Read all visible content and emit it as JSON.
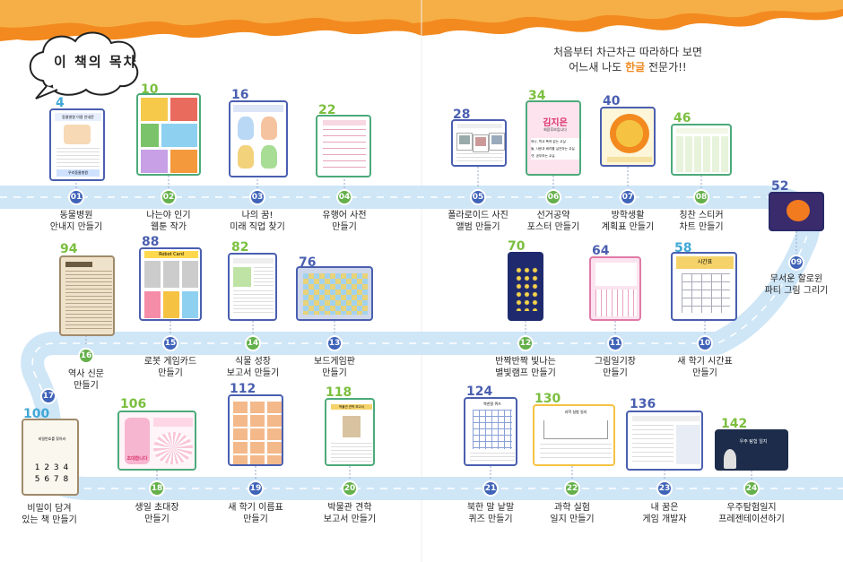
{
  "header": {
    "title": "이 책의 목차",
    "tagline_line1": "처음부터 차근차근 따라하다 보면",
    "tagline_line2_pre": "어느새 나도 ",
    "tagline_highlight": "한글",
    "tagline_line2_post": " 전문가!!"
  },
  "colors": {
    "wave": "#f39a2b",
    "road": "#cfe6f7",
    "badge_blue": "#3f63b8",
    "badge_green": "#64b04a",
    "page_blue": "#3fa7d6",
    "page_green": "#7bbf3f"
  },
  "items": [
    {
      "num": "01",
      "page": "4",
      "label": [
        "동물병원",
        "안내지 만들기"
      ]
    },
    {
      "num": "02",
      "page": "10",
      "label": [
        "나는야 인기",
        "웹툰 작가"
      ]
    },
    {
      "num": "03",
      "page": "16",
      "label": [
        "나의 꿈!",
        "미래 직업 찾기"
      ]
    },
    {
      "num": "04",
      "page": "22",
      "label": [
        "유행어 사전",
        "만들기"
      ]
    },
    {
      "num": "05",
      "page": "28",
      "label": [
        "폴라로이드 사진",
        "앨범 만들기"
      ]
    },
    {
      "num": "06",
      "page": "34",
      "label": [
        "선거공약",
        "포스터 만들기"
      ]
    },
    {
      "num": "07",
      "page": "40",
      "label": [
        "방학생활",
        "계획표 만들기"
      ]
    },
    {
      "num": "08",
      "page": "46",
      "label": [
        "칭찬 스티커",
        "차트 만들기"
      ]
    },
    {
      "num": "09",
      "page": "52",
      "label": [
        "무서운 할로윈",
        "파티 그림 그리기"
      ]
    },
    {
      "num": "10",
      "page": "58",
      "label": [
        "새 학기 시간표",
        "만들기"
      ]
    },
    {
      "num": "11",
      "page": "64",
      "label": [
        "그림일기장",
        "만들기"
      ]
    },
    {
      "num": "12",
      "page": "70",
      "label": [
        "반짝반짝 빛나는",
        "별빛램프 만들기"
      ]
    },
    {
      "num": "13",
      "page": "76",
      "label": [
        "보드게임판",
        "만들기"
      ]
    },
    {
      "num": "14",
      "page": "82",
      "label": [
        "식물 성장",
        "보고서 만들기"
      ]
    },
    {
      "num": "15",
      "page": "88",
      "label": [
        "로봇 게임카드",
        "만들기"
      ]
    },
    {
      "num": "16",
      "page": "94",
      "label": [
        "역사 신문",
        "만들기"
      ]
    },
    {
      "num": "17",
      "page": "100",
      "label": [
        "비밀이 담겨",
        "있는 책 만들기"
      ]
    },
    {
      "num": "18",
      "page": "106",
      "label": [
        "생일 초대장",
        "만들기"
      ]
    },
    {
      "num": "19",
      "page": "112",
      "label": [
        "새 학기 이름표",
        "만들기"
      ]
    },
    {
      "num": "20",
      "page": "118",
      "label": [
        "박물관 견학",
        "보고서 만들기"
      ]
    },
    {
      "num": "21",
      "page": "124",
      "label": [
        "북한 말 낱말",
        "퀴즈 만들기"
      ]
    },
    {
      "num": "22",
      "page": "130",
      "label": [
        "과학 실험",
        "일지 만들기"
      ]
    },
    {
      "num": "23",
      "page": "136",
      "label": [
        "내 꿈은",
        "게임 개발자"
      ]
    },
    {
      "num": "24",
      "page": "142",
      "label": [
        "우주탐험일지",
        "프레젠테이션하기"
      ]
    }
  ],
  "thumb_text": {
    "t1_header": "동물병원 이용 안내문",
    "t1_footer": "우리동물병원",
    "t6_name": "김지은",
    "t6_sub": "회장후보입니다",
    "t6_l1": "하나, 학교 폭력 없는 교실",
    "t6_l2": "둘, 사랑과 배려를 실천하는 교실",
    "t6_l3": "셋, 공부하는 교실",
    "t13_title": "Robot Card",
    "t10_title": "시간표",
    "t17_code1": "1 2 3 4",
    "t17_code2": "5 6 7 8",
    "t17_title": "비밀번호를 찾아라",
    "t18_title": "초대합니다",
    "t24_title": "우주 탐험 일지",
    "t22_title": "과학 실험 일지",
    "t20_title": "박물관 견학 보고서",
    "t21_title": "북한말 퀴즈"
  }
}
